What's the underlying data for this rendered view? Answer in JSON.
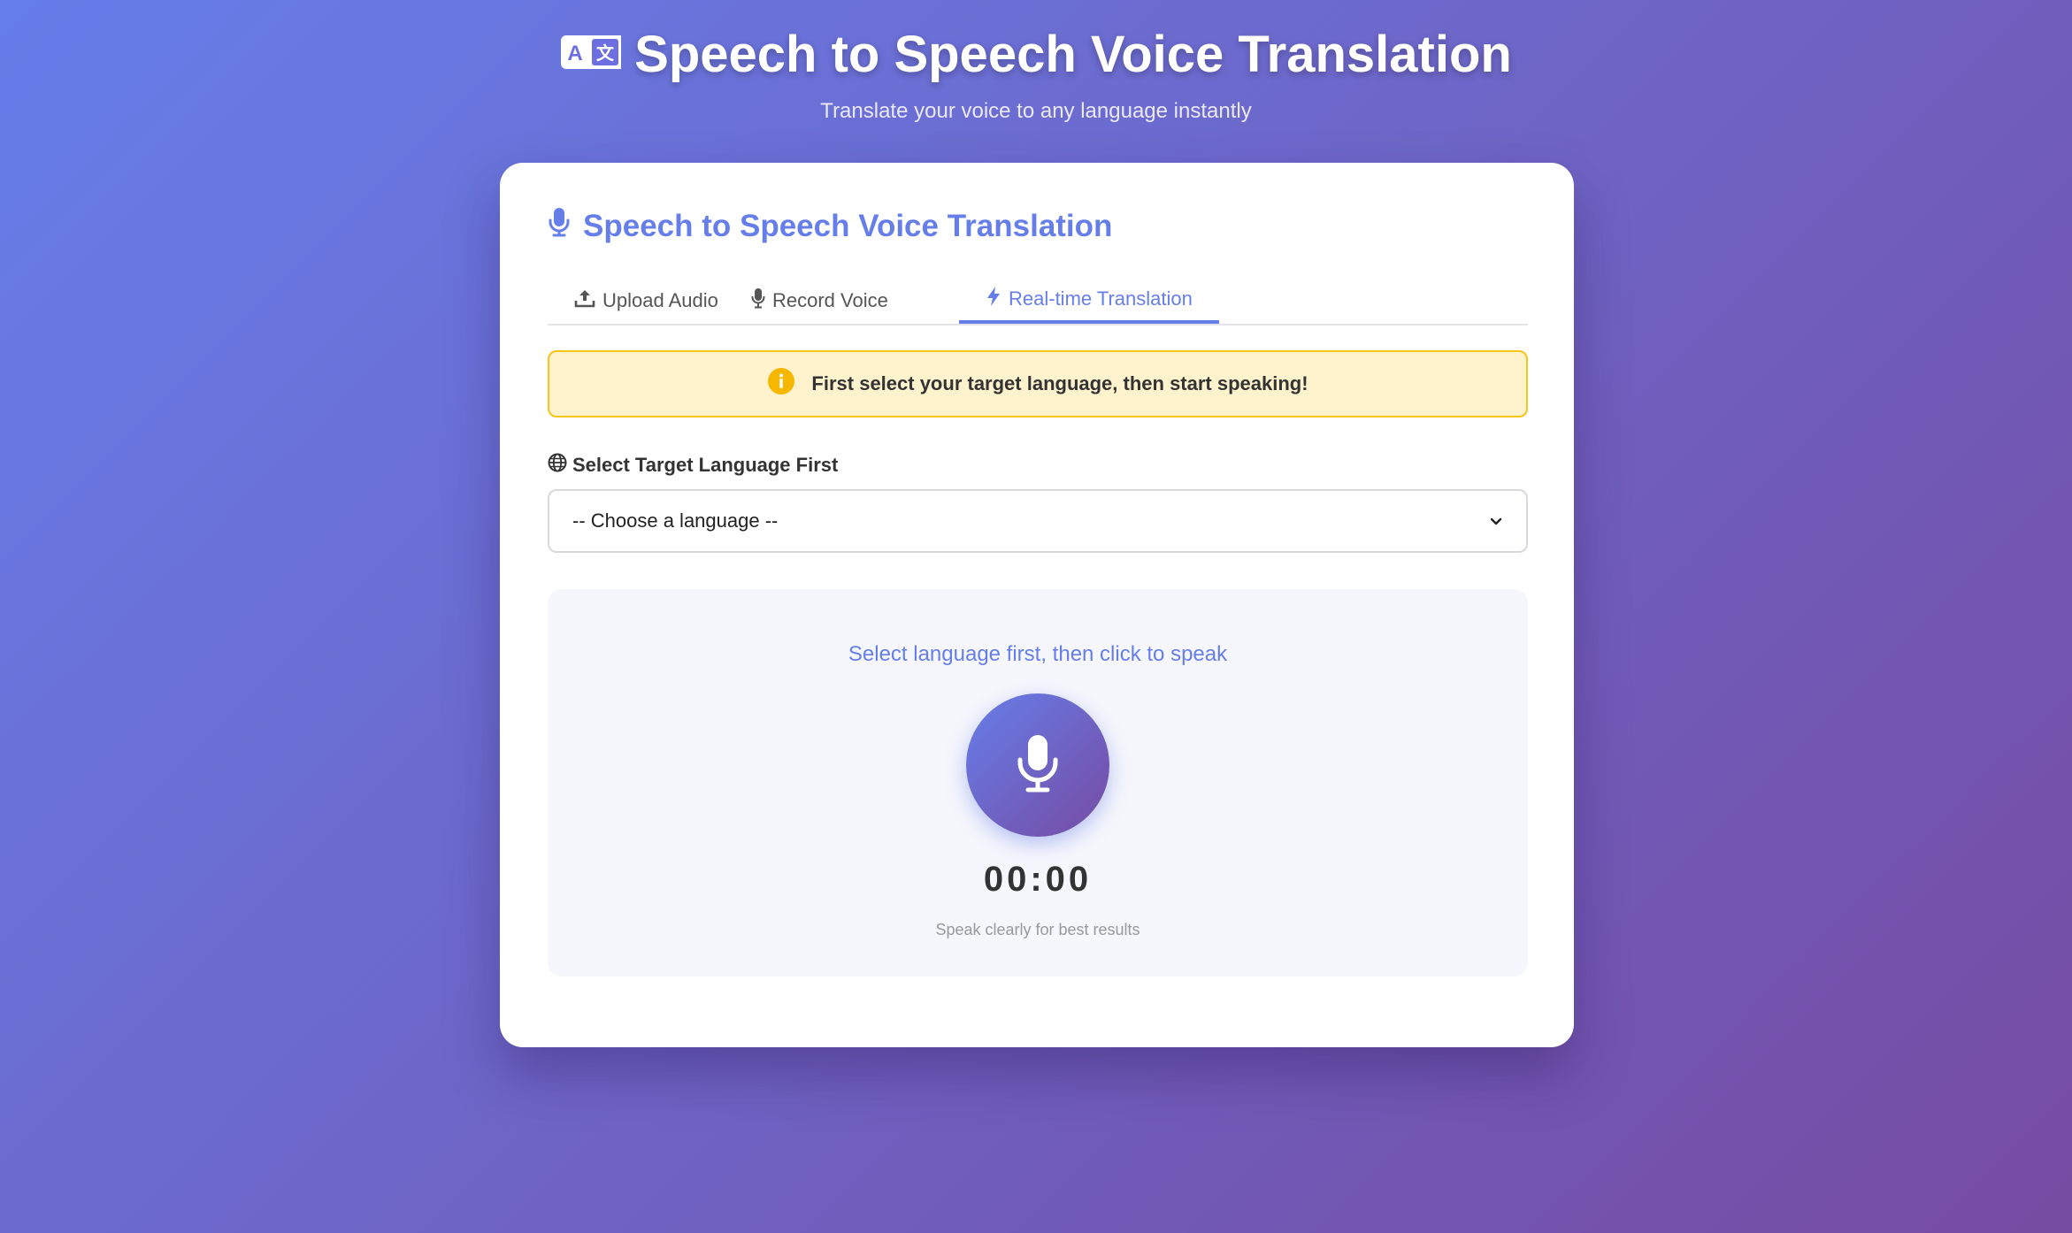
{
  "header": {
    "icon": "translate-icon",
    "title": "Speech to Speech Voice Translation",
    "subtitle": "Translate your voice to any language instantly"
  },
  "card": {
    "icon": "microphone-icon",
    "title": "Speech to Speech Voice Translation",
    "tabs": [
      {
        "label": "Upload Audio",
        "icon": "upload-icon",
        "active": false
      },
      {
        "label": "Record Voice",
        "icon": "microphone-icon",
        "active": false
      },
      {
        "label": "Real-time Translation",
        "icon": "bolt-icon",
        "active": true
      }
    ],
    "alert": {
      "icon": "info-icon",
      "text": "First select your target language, then start speaking!"
    },
    "language": {
      "icon": "globe-icon",
      "label": "Select Target Language First",
      "selected": "-- Choose a language --"
    },
    "recorder": {
      "prompt": "Select language first, then click to speak",
      "mic_icon": "microphone-icon",
      "timer": "00:00",
      "hint": "Speak clearly for best results"
    }
  },
  "colors": {
    "accent": "#667eea",
    "gradient_end": "#764ba2",
    "alert_bg": "#fff3cd",
    "alert_border": "#f5c518"
  }
}
